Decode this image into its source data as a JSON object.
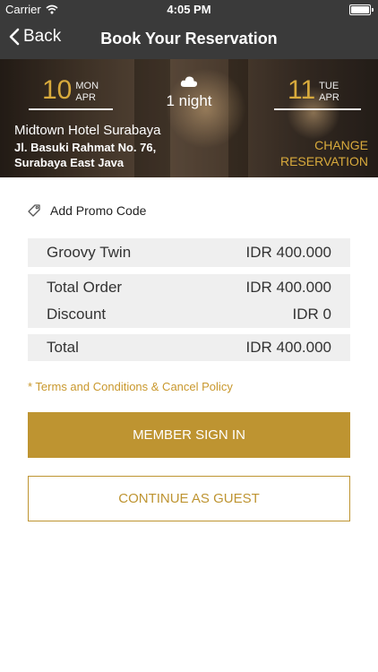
{
  "statusbar": {
    "carrier": "Carrier",
    "time": "4:05 PM"
  },
  "nav": {
    "back_label": "Back",
    "title": "Book Your Reservation"
  },
  "reservation": {
    "checkin": {
      "day": "10",
      "weekday": "MON",
      "month": "APR"
    },
    "checkout": {
      "day": "11",
      "weekday": "TUE",
      "month": "APR"
    },
    "nights": "1 night",
    "hotel_name": "Midtown Hotel Surabaya",
    "address_line1": "Jl. Basuki Rahmat No. 76,",
    "address_line2": "Surabaya East Java",
    "change_line1": "CHANGE",
    "change_line2": "RESERVATION"
  },
  "promo": {
    "label": "Add Promo Code"
  },
  "room": {
    "name": "Groovy Twin",
    "price": "IDR 400.000"
  },
  "summary": {
    "total_order_label": "Total Order",
    "total_order_value": "IDR 400.000",
    "discount_label": "Discount",
    "discount_value": "IDR 0"
  },
  "total": {
    "label": "Total",
    "value": "IDR 400.000"
  },
  "terms": "* Terms and Conditions & Cancel Policy",
  "buttons": {
    "member": "MEMBER SIGN IN",
    "guest": "CONTINUE AS GUEST"
  },
  "colors": {
    "accent": "#be9431",
    "navbar": "#3a3a3a",
    "row_bg": "#efefef"
  }
}
